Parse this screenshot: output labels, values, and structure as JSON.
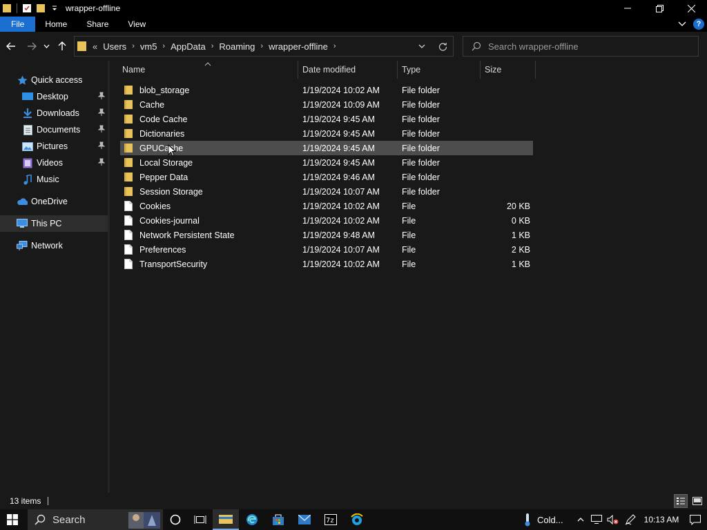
{
  "window": {
    "title": "wrapper-offline"
  },
  "ribbon": {
    "tabs": [
      "File",
      "Home",
      "Share",
      "View"
    ]
  },
  "address": {
    "overflow": "«",
    "crumbs": [
      "Users",
      "vm5",
      "AppData",
      "Roaming",
      "wrapper-offline"
    ]
  },
  "search": {
    "placeholder": "Search wrapper-offline"
  },
  "sidebar": {
    "items": [
      {
        "label": "Quick access",
        "icon": "star-icon"
      },
      {
        "label": "Desktop",
        "icon": "desktop-icon",
        "pinned": true
      },
      {
        "label": "Downloads",
        "icon": "download-icon",
        "pinned": true
      },
      {
        "label": "Documents",
        "icon": "documents-icon",
        "pinned": true
      },
      {
        "label": "Pictures",
        "icon": "pictures-icon",
        "pinned": true
      },
      {
        "label": "Videos",
        "icon": "videos-icon",
        "pinned": true
      },
      {
        "label": "Music",
        "icon": "music-icon"
      },
      {
        "label": "OneDrive",
        "icon": "cloud-icon"
      },
      {
        "label": "This PC",
        "icon": "computer-icon"
      },
      {
        "label": "Network",
        "icon": "network-icon"
      }
    ]
  },
  "columns": {
    "name": "Name",
    "date": "Date modified",
    "type": "Type",
    "size": "Size"
  },
  "files": [
    {
      "name": "blob_storage",
      "date": "1/19/2024 10:02 AM",
      "type": "File folder",
      "size": "",
      "kind": "folder"
    },
    {
      "name": "Cache",
      "date": "1/19/2024 10:09 AM",
      "type": "File folder",
      "size": "",
      "kind": "folder"
    },
    {
      "name": "Code Cache",
      "date": "1/19/2024 9:45 AM",
      "type": "File folder",
      "size": "",
      "kind": "folder"
    },
    {
      "name": "Dictionaries",
      "date": "1/19/2024 9:45 AM",
      "type": "File folder",
      "size": "",
      "kind": "folder"
    },
    {
      "name": "GPUCache",
      "date": "1/19/2024 9:45 AM",
      "type": "File folder",
      "size": "",
      "kind": "folder"
    },
    {
      "name": "Local Storage",
      "date": "1/19/2024 9:45 AM",
      "type": "File folder",
      "size": "",
      "kind": "folder"
    },
    {
      "name": "Pepper Data",
      "date": "1/19/2024 9:46 AM",
      "type": "File folder",
      "size": "",
      "kind": "folder"
    },
    {
      "name": "Session Storage",
      "date": "1/19/2024 10:07 AM",
      "type": "File folder",
      "size": "",
      "kind": "folder"
    },
    {
      "name": "Cookies",
      "date": "1/19/2024 10:02 AM",
      "type": "File",
      "size": "20 KB",
      "kind": "file"
    },
    {
      "name": "Cookies-journal",
      "date": "1/19/2024 10:02 AM",
      "type": "File",
      "size": "0 KB",
      "kind": "file"
    },
    {
      "name": "Network Persistent State",
      "date": "1/19/2024 9:48 AM",
      "type": "File",
      "size": "1 KB",
      "kind": "file"
    },
    {
      "name": "Preferences",
      "date": "1/19/2024 10:07 AM",
      "type": "File",
      "size": "2 KB",
      "kind": "file"
    },
    {
      "name": "TransportSecurity",
      "date": "1/19/2024 10:02 AM",
      "type": "File",
      "size": "1 KB",
      "kind": "file"
    }
  ],
  "status": {
    "count": "13 items"
  },
  "taskbar": {
    "search_label": "Search",
    "weather": "Cold...",
    "time": "10:13 AM"
  },
  "colors": {
    "accent": "#1a6fd1",
    "folder": "#e8c25a",
    "hover_row": "#4d4d4d"
  }
}
